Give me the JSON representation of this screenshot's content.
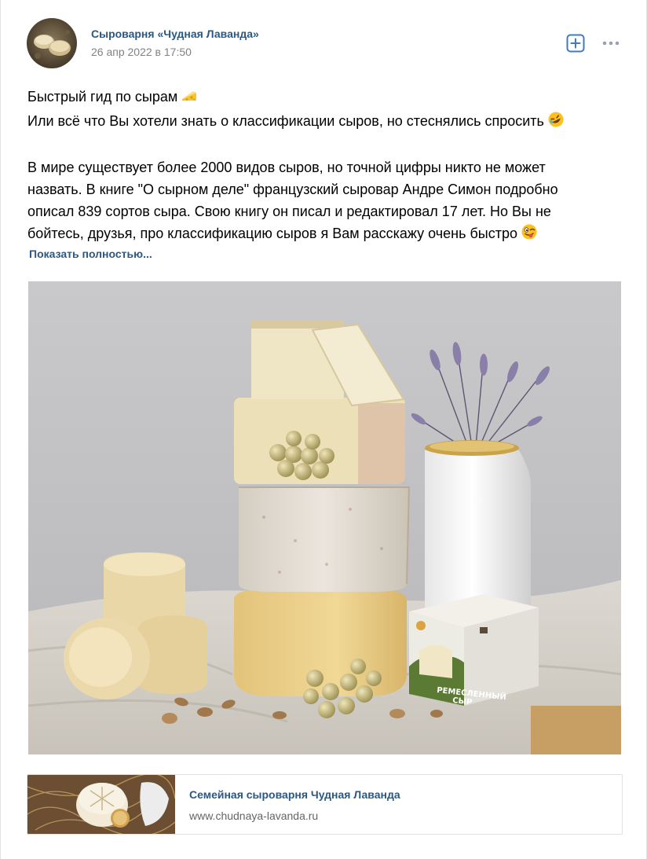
{
  "post": {
    "author": "Сыроварня «Чудная Лаванда»",
    "date": "26 апр 2022 в 17:50",
    "text_lines": [
      "Быстрый гид по сырам",
      "Или всё что Вы хотели знать о классификации сыров, но стеснялись спросить",
      "В мире существует более 2000 видов сыров, но точной цифры никто не может",
      "назвать. В книге \"О сырном деле\" французский сыровар Андре Симон подробно",
      "описал 839 сортов сыра. Свою книгу он писал и редактировал 17 лет. Но Вы не",
      "бойтесь, друзья, про классификацию сыров я Вам расскажу очень быстро"
    ],
    "show_more": "Показать полностью...",
    "photo_caption": "РЕМЕСЛЕННЫЙ СЫР"
  },
  "snippet": {
    "title": "Семейная сыроварня Чудная Лаванда",
    "url": "www.chudnaya-lavanda.ru"
  },
  "icons": {
    "add": "plus-square-icon",
    "more": "more-dots-icon",
    "emoji1": "cheese-emoji",
    "emoji2": "rofl-emoji",
    "emoji3": "winking-tongue-emoji"
  },
  "colors": {
    "link": "#2a5885",
    "muted": "#828282",
    "icon_accent": "#3f7bbf"
  }
}
